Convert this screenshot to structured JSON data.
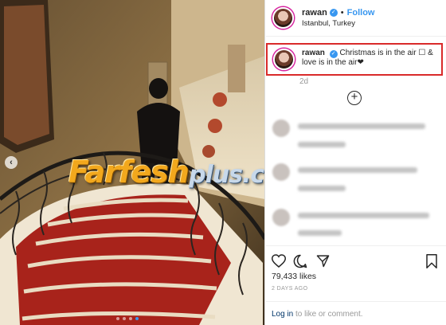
{
  "post": {
    "username": "rawan",
    "follow_label": "Follow",
    "separator": "•",
    "location": "Istanbul, Turkey",
    "caption": "Christmas is in the air ☐ & love is in the air❤",
    "time_ago": "2d",
    "likes": "79,433 likes",
    "date": "2 DAYS AGO",
    "login_link": "Log in",
    "login_suffix": " to like or comment."
  },
  "watermark": {
    "main": "Farfesh",
    "sub": "plus.com"
  },
  "icons": {
    "prev": "‹",
    "verified": "✓",
    "load_more": "+"
  },
  "carousel": {
    "total_slides": 4,
    "active_slide": 4
  },
  "colors": {
    "accent": "#3897f0",
    "highlight_border": "#d92a2a",
    "muted_text": "#999999",
    "link_dark": "#003569"
  }
}
